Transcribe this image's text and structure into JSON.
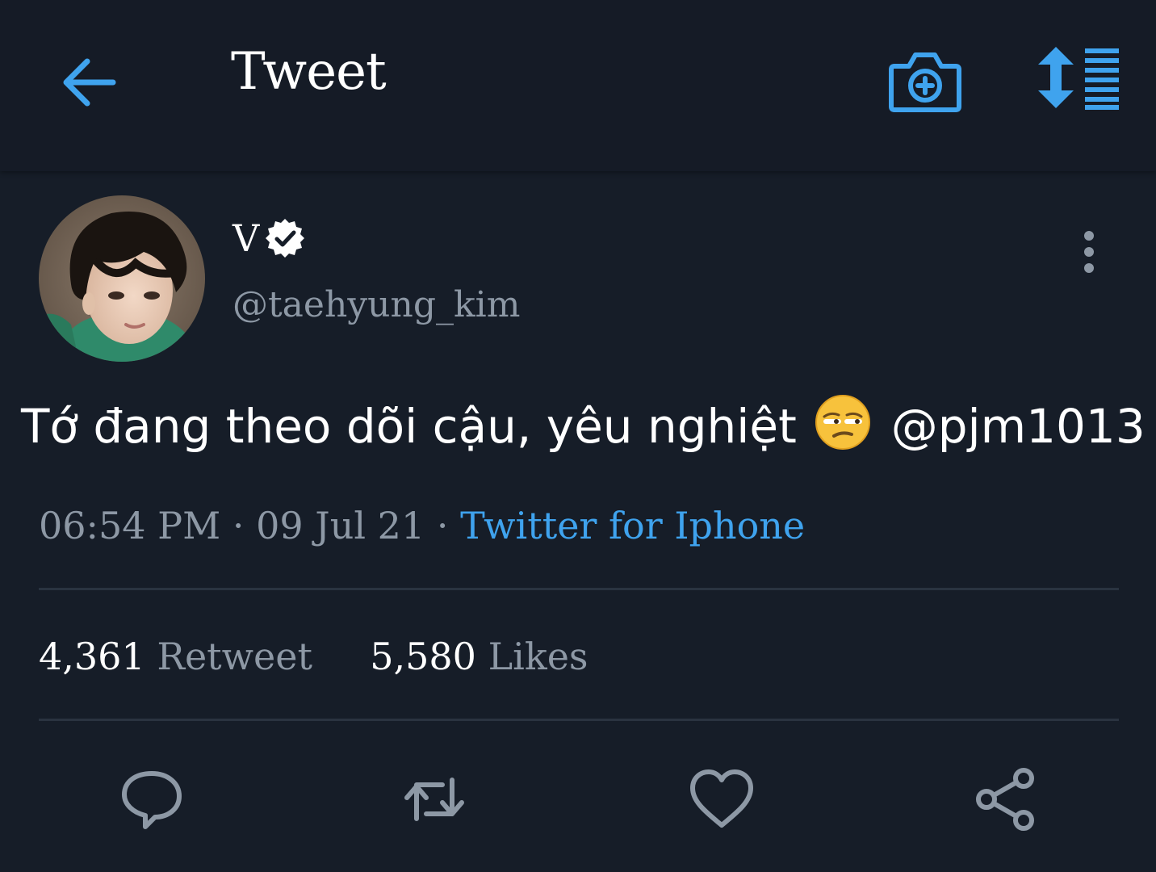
{
  "header": {
    "title": "Tweet",
    "back_icon": "back-arrow-icon",
    "camera_icon": "camera-plus-icon",
    "sort_icon": "sort-list-icon"
  },
  "tweet": {
    "display_name": "V",
    "verified": true,
    "handle": "@taehyung_kim",
    "text_before_emoji": "Tớ đang theo dõi cậu, yêu nghiệt",
    "emoji": "unamused-face",
    "mention": "@pjm1013",
    "time": "06:54 PM",
    "date": "09 Jul 21",
    "separator": "·",
    "source": "Twitter for Iphone"
  },
  "stats": {
    "retweets_count": "4,361",
    "retweets_label": "Retweet",
    "likes_count": "5,580",
    "likes_label": "Likes"
  },
  "actions": [
    "reply-icon",
    "retweet-icon",
    "like-icon",
    "share-icon"
  ],
  "colors": {
    "background": "#161d28",
    "header": "#151b26",
    "accent": "#3fa3ee",
    "muted": "#8d98a5",
    "divider": "#2a3340"
  }
}
